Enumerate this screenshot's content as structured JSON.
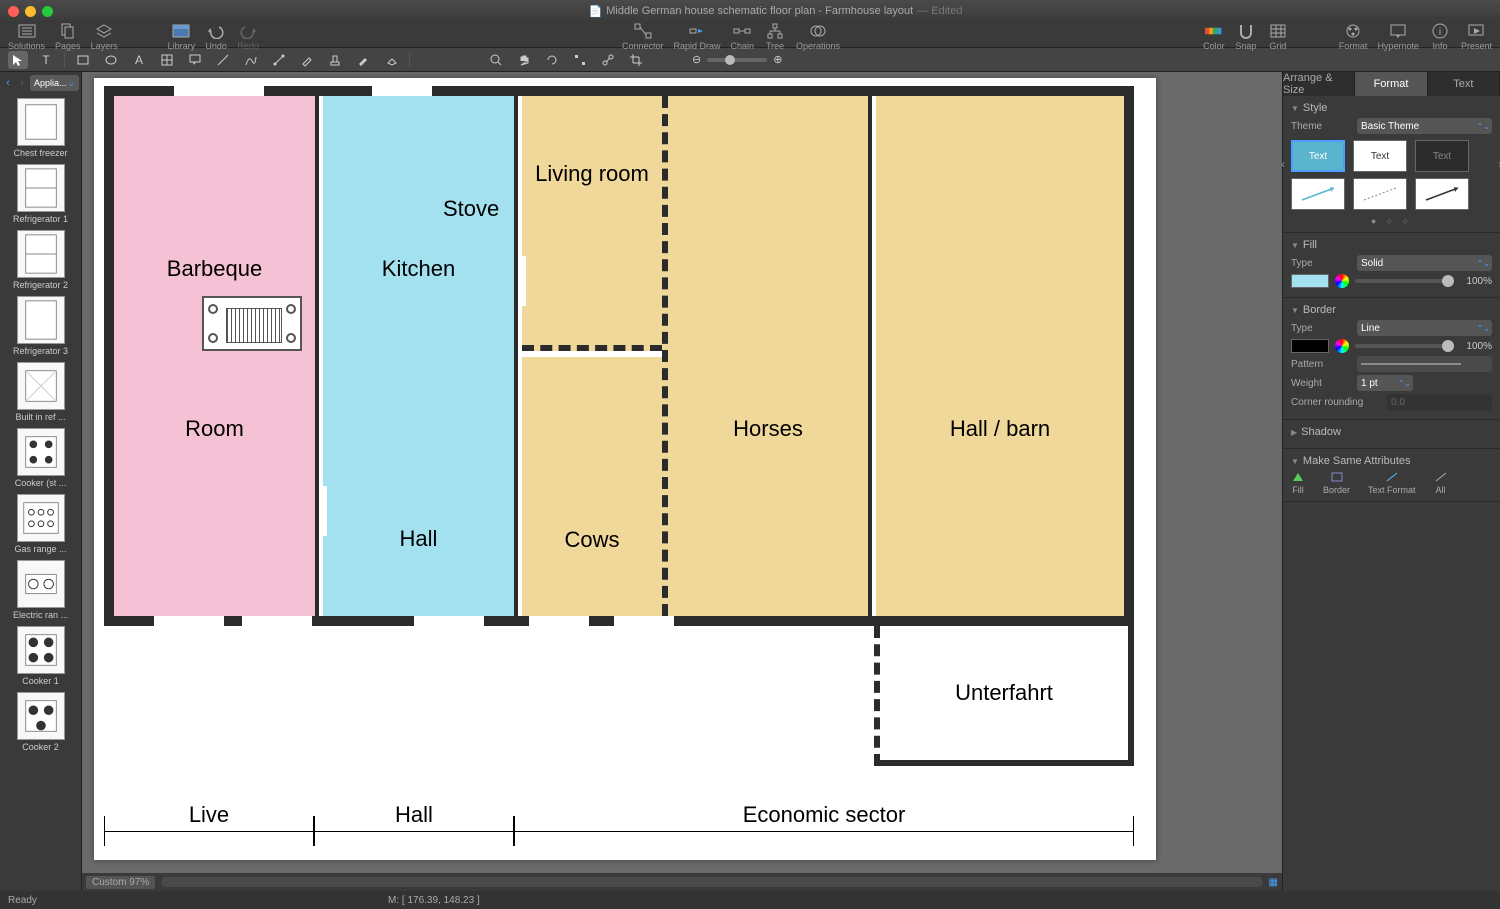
{
  "title": {
    "doc": "Middle German house schematic floor plan - Farmhouse layout",
    "edited": "— Edited"
  },
  "toolbar": {
    "left": [
      {
        "n": "solutions",
        "l": "Solutions"
      },
      {
        "n": "pages",
        "l": "Pages"
      },
      {
        "n": "layers",
        "l": "Layers"
      }
    ],
    "mid": [
      {
        "n": "library",
        "l": "Library"
      },
      {
        "n": "undo",
        "l": "Undo"
      },
      {
        "n": "redo",
        "l": "Redo"
      }
    ],
    "mid2": [
      {
        "n": "connector",
        "l": "Connector"
      },
      {
        "n": "rapiddraw",
        "l": "Rapid Draw"
      },
      {
        "n": "chain",
        "l": "Chain"
      },
      {
        "n": "tree",
        "l": "Tree"
      },
      {
        "n": "operations",
        "l": "Operations"
      }
    ],
    "right": [
      {
        "n": "color",
        "l": "Color"
      },
      {
        "n": "snap",
        "l": "Snap"
      },
      {
        "n": "grid",
        "l": "Grid"
      }
    ],
    "far": [
      {
        "n": "format",
        "l": "Format"
      },
      {
        "n": "hypernote",
        "l": "Hypernote"
      },
      {
        "n": "info",
        "l": "Info"
      },
      {
        "n": "present",
        "l": "Present"
      }
    ]
  },
  "leftpanel": {
    "dropdown": "Applia...",
    "items": [
      {
        "l": "Chest freezer"
      },
      {
        "l": "Refrigerator 1"
      },
      {
        "l": "Refrigerator 2"
      },
      {
        "l": "Refrigerator 3"
      },
      {
        "l": "Built in ref ..."
      },
      {
        "l": "Cooker (st ..."
      },
      {
        "l": "Gas range ..."
      },
      {
        "l": "Electric ran ..."
      },
      {
        "l": "Cooker 1"
      },
      {
        "l": "Cooker 2"
      }
    ]
  },
  "plan": {
    "barbeque": "Barbeque",
    "stove": "Stove",
    "room": "Room",
    "kitchen": "Kitchen",
    "hall": "Hall",
    "living": "Living room",
    "cows": "Cows",
    "horses": "Horses",
    "hallbarn": "Hall / barn",
    "unterfahrt": "Unterfahrt",
    "live": "Live",
    "hall2": "Hall",
    "economic": "Economic sector"
  },
  "zoom": {
    "label": "Custom 97%",
    "coord": "M: [ 176.39, 148.23 ]"
  },
  "rightpanel": {
    "tabs": [
      "Arrange & Size",
      "Format",
      "Text"
    ],
    "style": {
      "h": "Style",
      "theme_l": "Theme",
      "theme_v": "Basic Theme",
      "box": "Text"
    },
    "fill": {
      "h": "Fill",
      "type_l": "Type",
      "type_v": "Solid",
      "pct": "100%"
    },
    "border": {
      "h": "Border",
      "type_l": "Type",
      "type_v": "Line",
      "pct": "100%",
      "pattern_l": "Pattern",
      "weight_l": "Weight",
      "weight_v": "1 pt",
      "corner_l": "Corner rounding",
      "corner_v": "0.0"
    },
    "shadow": {
      "h": "Shadow"
    },
    "same": {
      "h": "Make Same Attributes",
      "items": [
        "Fill",
        "Border",
        "Text Format",
        "All"
      ]
    }
  },
  "status": {
    "ready": "Ready"
  }
}
